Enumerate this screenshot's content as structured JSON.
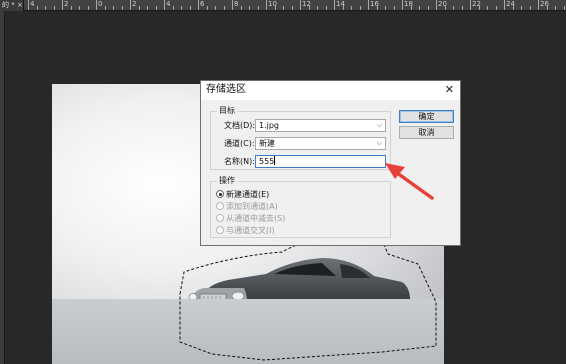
{
  "editor": {
    "tab_label": "的 *",
    "close_glyph": "×",
    "ruler_labels": [
      "4",
      "2",
      "0",
      "2",
      "4",
      "6",
      "8",
      "10",
      "12",
      "14",
      "16",
      "18",
      "20",
      "22",
      "24",
      "26",
      "28"
    ]
  },
  "dialog": {
    "title": "存储选区",
    "close_glyph": "✕",
    "target_group": {
      "legend": "目标",
      "document_label": "文档(D):",
      "document_value": "1.jpg",
      "channel_label": "通道(C):",
      "channel_value": "新建",
      "name_label": "名称(N):",
      "name_value": "555"
    },
    "operation_group": {
      "legend": "操作",
      "options": [
        "新建通道(E)",
        "添加到通道(A)",
        "从通道中减去(S)",
        "与通道交叉(I)"
      ],
      "selected_index": 0
    },
    "ok_label": "确定",
    "cancel_label": "取消",
    "chevron_glyph": "⌵"
  },
  "photo": {
    "plate_text": "1868"
  },
  "colors": {
    "workspace": "#282828",
    "arrow": "#e8413b",
    "dialog_bg": "#f0f0f0",
    "focus": "#3c7fc4"
  }
}
